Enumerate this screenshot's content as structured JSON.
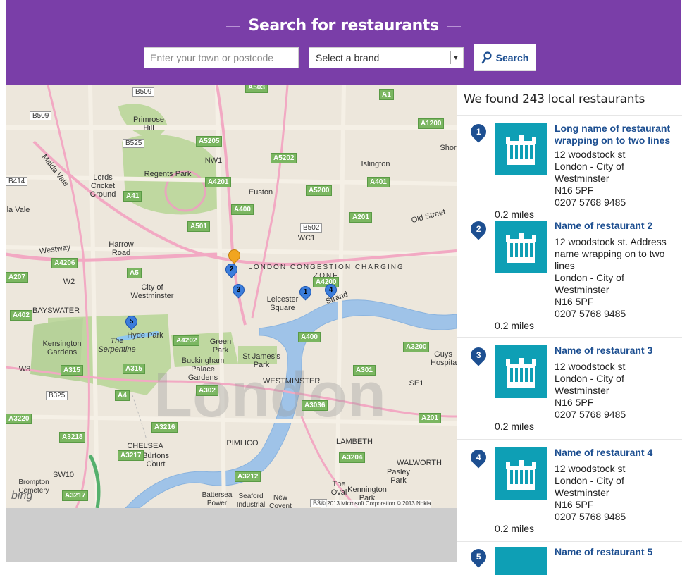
{
  "header": {
    "title": "Search for restaurants",
    "search_placeholder": "Enter your town or postcode",
    "brand_selected": "Select a brand",
    "search_button": "Search",
    "accent_color": "#7a3ea8"
  },
  "map": {
    "labels": {
      "primrose_hill": "Primrose Hill",
      "regents_park": "Regents Park",
      "nw1": "NW1",
      "islington": "Islington",
      "lords": "Lords Cricket Ground",
      "euston": "Euston",
      "maida_vale": "Maida Vale",
      "maida_vale2": "la Vale",
      "wc1": "WC1",
      "old_street": "Old Street",
      "westway": "Westway",
      "harrow_road": "Harrow Road",
      "congestion": "LONDON CONGESTION CHARGING ZONE",
      "w2": "W2",
      "city_of_westminster": "City of Westminster",
      "leicester_square": "Leicester Square",
      "strand": "Strand",
      "bayswater": "BAYSWATER",
      "hyde_park": "Hyde Park",
      "kensington_gardens": "Kensington Gardens",
      "serpentine": "The Serpentine",
      "green_park": "Green Park",
      "st_james_park": "St James's Park",
      "buckingham": "Buckingham Palace Gardens",
      "westminster": "WESTMINSTER",
      "guys_hospital": "Guys Hospital",
      "se1": "SE1",
      "w8": "W8",
      "chelsea": "CHELSEA",
      "burtons_court": "Burtons Court",
      "pimlico": "PIMLICO",
      "lambeth": "LAMBETH",
      "walworth": "WALWORTH",
      "pasley_park": "Pasley Park",
      "sw10": "SW10",
      "brompton": "Brompton Cemetery",
      "the_oval": "The Oval",
      "kennington": "Kennington Park",
      "battersea": "Battersea Power",
      "seaford": "Seaford Industrial",
      "new_covent": "New Covent",
      "shor": "Shor",
      "copyright": "© 2013 Microsoft Corporation © 2013 Nokia",
      "bing": "bing"
    },
    "roads": [
      "B509",
      "A503",
      "A1",
      "B509",
      "A1200",
      "B525",
      "A5205",
      "NW1",
      "A5202",
      "B414",
      "A4201",
      "A5200",
      "A401",
      "A41",
      "A400",
      "A201",
      "A501",
      "B502",
      "A4206",
      "A5",
      "A4200",
      "A207",
      "A402",
      "A4202",
      "A400",
      "A3200",
      "A315",
      "A315",
      "A302",
      "A301",
      "B325",
      "A4",
      "A3036",
      "A3220",
      "A3216",
      "A3218",
      "A201",
      "A3217",
      "A3204",
      "A3212",
      "A3217",
      "B30"
    ],
    "pins": [
      "1",
      "2",
      "3",
      "4",
      "5"
    ]
  },
  "results": {
    "count_text": "We found 243 local restaurants",
    "items": [
      {
        "num": "1",
        "name": "Long name of restaurant wrapping on to two lines",
        "addr": [
          "12 woodstock st",
          "London - City of",
          "Westminster",
          "N16 5PF",
          "0207 5768 9485"
        ],
        "dist": "0.2 miles"
      },
      {
        "num": "2",
        "name": "Name of restaurant 2",
        "addr": [
          "12 woodstock st. Address",
          "name wrapping on to two",
          "lines",
          "London - City of",
          "Westminster",
          "N16 5PF",
          "0207 5768 9485"
        ],
        "dist": "0.2 miles"
      },
      {
        "num": "3",
        "name": "Name of restaurant 3",
        "addr": [
          "12 woodstock st",
          "London - City of",
          "Westminster",
          "N16 5PF",
          "0207 5768 9485"
        ],
        "dist": "0.2 miles"
      },
      {
        "num": "4",
        "name": "Name of restaurant 4",
        "addr": [
          "12 woodstock st",
          "London - City of",
          "Westminster",
          "N16 5PF",
          "0207 5768 9485"
        ],
        "dist": "0.2 miles"
      },
      {
        "num": "5",
        "name": "Name of restaurant 5",
        "addr": [],
        "dist": ""
      }
    ]
  }
}
